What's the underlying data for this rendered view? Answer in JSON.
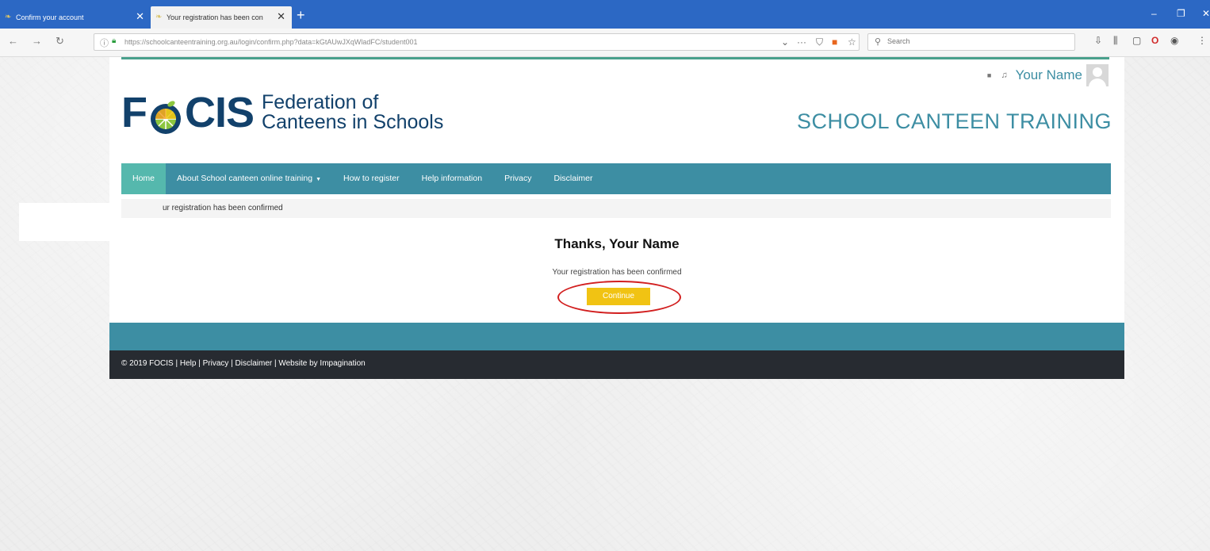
{
  "browser": {
    "tabs": [
      {
        "title": "Confirm your account",
        "active": false
      },
      {
        "title": "Your registration has been con",
        "active": true
      }
    ],
    "new_tab": "+",
    "url": "https://schoolcanteentraining.org.au/login/confirm.php?data=kGtAUwJXqWladFC/student001",
    "search_placeholder": "Search",
    "accent_color": "#2c68c4"
  },
  "header": {
    "username": "Your Name",
    "logo_word_left": "F",
    "logo_word_right": "CIS",
    "logo_sub_line1": "Federation of",
    "logo_sub_line2": "Canteens in Schools",
    "site_title": "SCHOOL CANTEEN TRAINING",
    "brand_color": "#3d8ea3",
    "logo_color": "#12416b"
  },
  "nav": {
    "items": [
      {
        "label": "Home",
        "active": true
      },
      {
        "label": "About School canteen online training",
        "dropdown": true
      },
      {
        "label": "How to register"
      },
      {
        "label": "Help information"
      },
      {
        "label": "Privacy"
      },
      {
        "label": "Disclaimer"
      }
    ]
  },
  "breadcrumb": "ur registration has been confirmed",
  "main": {
    "heading": "Thanks, Your Name",
    "message": "Your registration has been confirmed",
    "continue_label": "Continue",
    "button_color": "#f1c313"
  },
  "footer": {
    "text": "© 2019 FOCIS | Help | Privacy | Disclaimer | Website by Impagination"
  }
}
